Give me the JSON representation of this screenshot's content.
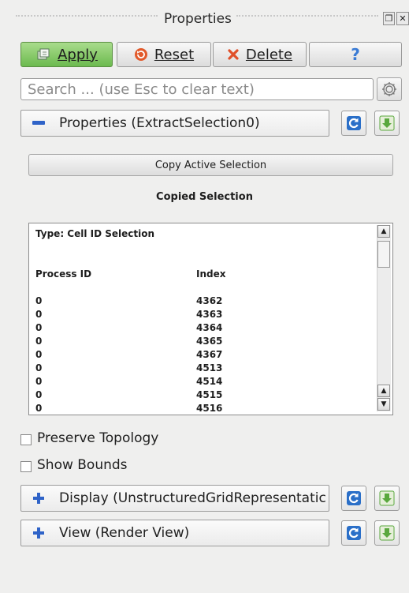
{
  "window": {
    "title": "Properties"
  },
  "toolbar": {
    "apply_label": "Apply",
    "reset_label": "Reset",
    "delete_label": "Delete",
    "help_label": "?"
  },
  "search": {
    "placeholder": "Search ... (use Esc to clear text)"
  },
  "properties_section": {
    "label": "Properties (ExtractSelection0)"
  },
  "copy_button": {
    "label": "Copy Active Selection"
  },
  "copied_selection": {
    "label": "Copied Selection",
    "type_text": "Type: Cell ID Selection",
    "col_process": "Process ID",
    "col_index": "Index",
    "rows": [
      {
        "pid": "0",
        "index": "4362"
      },
      {
        "pid": "0",
        "index": "4363"
      },
      {
        "pid": "0",
        "index": "4364"
      },
      {
        "pid": "0",
        "index": "4365"
      },
      {
        "pid": "0",
        "index": "4367"
      },
      {
        "pid": "0",
        "index": "4513"
      },
      {
        "pid": "0",
        "index": "4514"
      },
      {
        "pid": "0",
        "index": "4515"
      },
      {
        "pid": "0",
        "index": "4516"
      }
    ]
  },
  "options": {
    "preserve_topology": "Preserve Topology",
    "show_bounds": "Show Bounds"
  },
  "display_section": {
    "label": "Display (UnstructuredGridRepresentatic"
  },
  "view_section": {
    "label": "View (Render View)"
  },
  "colors": {
    "apply_green": "#7cc35d",
    "reset_red": "#e25a2b",
    "delete_red": "#e0502a",
    "help_blue": "#3a7bd5",
    "section_blue": "#2f63c8",
    "refresh_blue": "#2a6fc8",
    "download_green": "#5aa83e"
  },
  "icons": {
    "apply": "apply-icon",
    "reset": "reset-icon",
    "delete": "delete-icon",
    "help": "help-icon",
    "gear": "gear-icon",
    "refresh": "refresh-icon",
    "download": "download-icon"
  }
}
